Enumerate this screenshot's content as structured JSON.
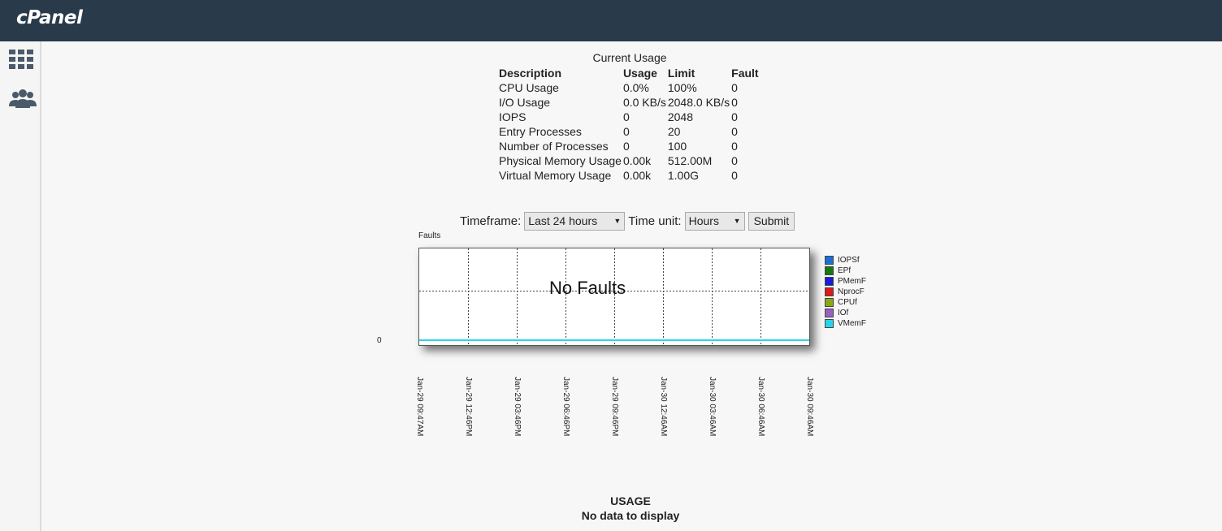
{
  "app": {
    "logo": "cPanel"
  },
  "sidebar": {
    "items": [
      {
        "icon": "grid-icon"
      },
      {
        "icon": "users-icon"
      }
    ]
  },
  "current_usage": {
    "title": "Current Usage",
    "headers": [
      "Description",
      "Usage",
      "Limit",
      "Fault"
    ],
    "rows": [
      [
        "CPU Usage",
        "0.0%",
        "100%",
        "0"
      ],
      [
        "I/O Usage",
        "0.0 KB/s",
        "2048.0 KB/s",
        "0"
      ],
      [
        "IOPS",
        "0",
        "2048",
        "0"
      ],
      [
        "Entry Processes",
        "0",
        "20",
        "0"
      ],
      [
        "Number of Processes",
        "0",
        "100",
        "0"
      ],
      [
        "Physical Memory Usage",
        "0.00k",
        "512.00M",
        "0"
      ],
      [
        "Virtual Memory Usage",
        "0.00k",
        "1.00G",
        "0"
      ]
    ]
  },
  "controls": {
    "timeframe_label": "Timeframe:",
    "timeframe_value": "Last 24 hours",
    "timeunit_label": "Time unit:",
    "timeunit_value": "Hours",
    "submit_label": "Submit"
  },
  "chart_data": {
    "type": "line",
    "title": "Faults",
    "overlay_text": "No Faults",
    "y_tick": "0",
    "x": [
      "Jan-29 09:47AM",
      "Jan-29 12:46PM",
      "Jan-29 03:46PM",
      "Jan-29 06:46PM",
      "Jan-29 09:46PM",
      "Jan-30 12:46AM",
      "Jan-30 03:46AM",
      "Jan-30 06:46AM",
      "Jan-30 09:46AM"
    ],
    "series": [
      {
        "name": "IOPSf",
        "color": "#1a6fd6",
        "values": [
          0,
          0,
          0,
          0,
          0,
          0,
          0,
          0,
          0
        ]
      },
      {
        "name": "EPf",
        "color": "#117a11",
        "values": [
          0,
          0,
          0,
          0,
          0,
          0,
          0,
          0,
          0
        ]
      },
      {
        "name": "PMemF",
        "color": "#1a1ae0",
        "values": [
          0,
          0,
          0,
          0,
          0,
          0,
          0,
          0,
          0
        ]
      },
      {
        "name": "NprocF",
        "color": "#e01818",
        "values": [
          0,
          0,
          0,
          0,
          0,
          0,
          0,
          0,
          0
        ]
      },
      {
        "name": "CPUf",
        "color": "#8aa812",
        "values": [
          0,
          0,
          0,
          0,
          0,
          0,
          0,
          0,
          0
        ]
      },
      {
        "name": "IOf",
        "color": "#9a5fc4",
        "values": [
          0,
          0,
          0,
          0,
          0,
          0,
          0,
          0,
          0
        ]
      },
      {
        "name": "VMemF",
        "color": "#2ad4e8",
        "values": [
          0,
          0,
          0,
          0,
          0,
          0,
          0,
          0,
          0
        ]
      }
    ],
    "grid": true,
    "legend": "right"
  },
  "usage_section": {
    "title": "USAGE",
    "message": "No data to display"
  }
}
